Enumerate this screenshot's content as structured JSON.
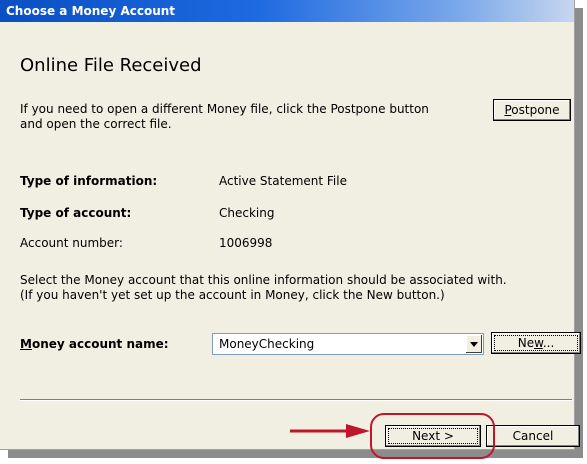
{
  "window": {
    "title": "Choose a Money Account"
  },
  "heading": "Online File Received",
  "intro": {
    "line1": "If you need to open a different Money file, click the Postpone button",
    "line2": "and open the correct file."
  },
  "buttons": {
    "postpone": {
      "underline": "P",
      "rest": "ostpone"
    },
    "new": {
      "pre": "Ne",
      "underline": "w",
      "rest": "..."
    },
    "next": "Next >",
    "cancel": "Cancel"
  },
  "info": {
    "type_of_information_label": "Type of information:",
    "type_of_information_value": "Active Statement File",
    "type_of_account_label": "Type of account:",
    "type_of_account_value": "Checking",
    "account_number_label": "Account number:",
    "account_number_value": "1006998"
  },
  "instructions": {
    "line1": "Select the Money account that this online information should be associated with.",
    "line2": "(If you haven't yet set up the account in Money, click the New button.)"
  },
  "money_account": {
    "label_underline": "M",
    "label_rest": "oney account name:",
    "selected": "MoneyChecking"
  },
  "colors": {
    "title_gradient_start": "#0a4fc4",
    "dialog_bg": "#f1efe2",
    "highlight_ring": "#c0162b",
    "arrow": "#c0162b"
  },
  "icons": {
    "combo_dropdown": "chevron-down-icon",
    "callout_arrow": "arrow-right-icon"
  }
}
